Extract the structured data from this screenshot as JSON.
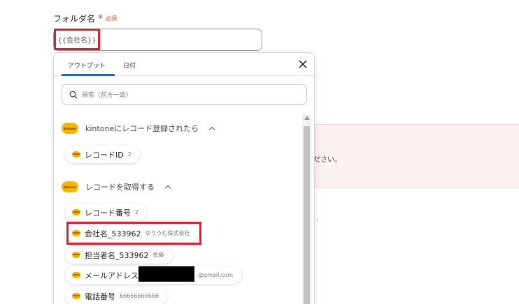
{
  "field": {
    "label": "フォルダ名",
    "required_mark": "*",
    "required_text": "必須",
    "token": "{{会社名}}"
  },
  "background": {
    "text": "ださい。",
    "mark": ","
  },
  "popup": {
    "tabs": [
      "アウトプット",
      "日付"
    ],
    "active_tab": "アウトプット",
    "search_placeholder": "検索（前方一致）",
    "sections": [
      {
        "logo_text": "kintone",
        "title": "kintoneにレコード登録されたら",
        "expanded": true,
        "items": [
          {
            "name": "レコードID",
            "value": "2"
          }
        ]
      },
      {
        "logo_text": "kintone",
        "title": "レコードを取得する",
        "expanded": true,
        "items": [
          {
            "name": "レコード番号",
            "value": "2"
          },
          {
            "name": "会社名_533962",
            "value": "ゆううむ株式会社"
          },
          {
            "name": "担当者名_533962",
            "value": "佐藤"
          },
          {
            "name": "メールアドレス",
            "value": "@gmail.com"
          },
          {
            "name": "電話番号",
            "value": "66666666666"
          }
        ]
      }
    ]
  },
  "colors": {
    "required": "#e2413a",
    "highlight": "#e21d2f",
    "tab_accent": "#2b5fb8",
    "kintone_yellow": "#f4b400",
    "error_bg": "#fdf2f2"
  }
}
